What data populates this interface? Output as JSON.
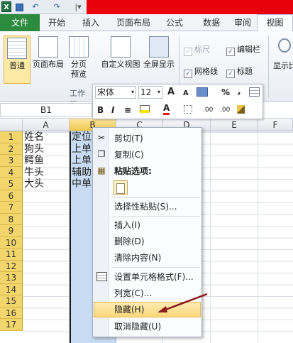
{
  "titlebar": {
    "app_icon": "X",
    "qa_undo": "↶",
    "qa_redo": "↷",
    "qa_more": "|▾"
  },
  "tabs": [
    "文件",
    "开始",
    "插入",
    "页面布局",
    "公式",
    "数据",
    "审阅",
    "视图"
  ],
  "ribbon": {
    "normal": "普通",
    "page_layout": "页面布局",
    "page_break": [
      "分页",
      "预览"
    ],
    "custom_view": "自定义视图",
    "full_screen": "全屏显示",
    "workbook_views_group": "工作簿",
    "ruler": "标尺",
    "formula_bar": "编辑栏",
    "gridlines": "网格线",
    "headings": "标题",
    "show_label": "显示比"
  },
  "name_box": "B1",
  "columns": [
    "A",
    "B",
    "C",
    "D",
    "E",
    "F"
  ],
  "rows": [
    "1",
    "2",
    "3",
    "4",
    "5",
    "6",
    "7",
    "8",
    "9",
    "10",
    "11",
    "12",
    "13",
    "14",
    "15",
    "16",
    "17"
  ],
  "cells_a": [
    "姓名",
    "狗头",
    "鳄鱼",
    "牛头",
    "大头"
  ],
  "cells_b": [
    "定位",
    "上单",
    "上单",
    "辅助",
    "中单"
  ],
  "mini_toolbar": {
    "font": "宋体",
    "size": "12",
    "grow": "A",
    "shrink": "A",
    "percent": "%",
    "comma": ",",
    "bold": "B",
    "italic": "I",
    "align": "≡",
    "font_color": "A",
    "dec_inc": ".00",
    "dec_dec": ".00"
  },
  "context_menu": {
    "cut": "剪切(T)",
    "copy": "复制(C)",
    "paste_options": "粘贴选项:",
    "paste_special": "选择性粘贴(S)...",
    "insert": "插入(I)",
    "delete": "删除(D)",
    "clear": "清除内容(N)",
    "format_cells": "设置单元格格式(F)...",
    "col_width": "列宽(C)...",
    "hide": "隐藏(H)",
    "unhide": "取消隐藏(U)"
  },
  "colors": {
    "file_tab": "#2d8b3f",
    "title_red": "#e8000b",
    "row_header": "#f3d66b",
    "selected_col": "#c7dcf2",
    "highlight": "#fbd97a",
    "arrow": "#8b1a1a"
  }
}
